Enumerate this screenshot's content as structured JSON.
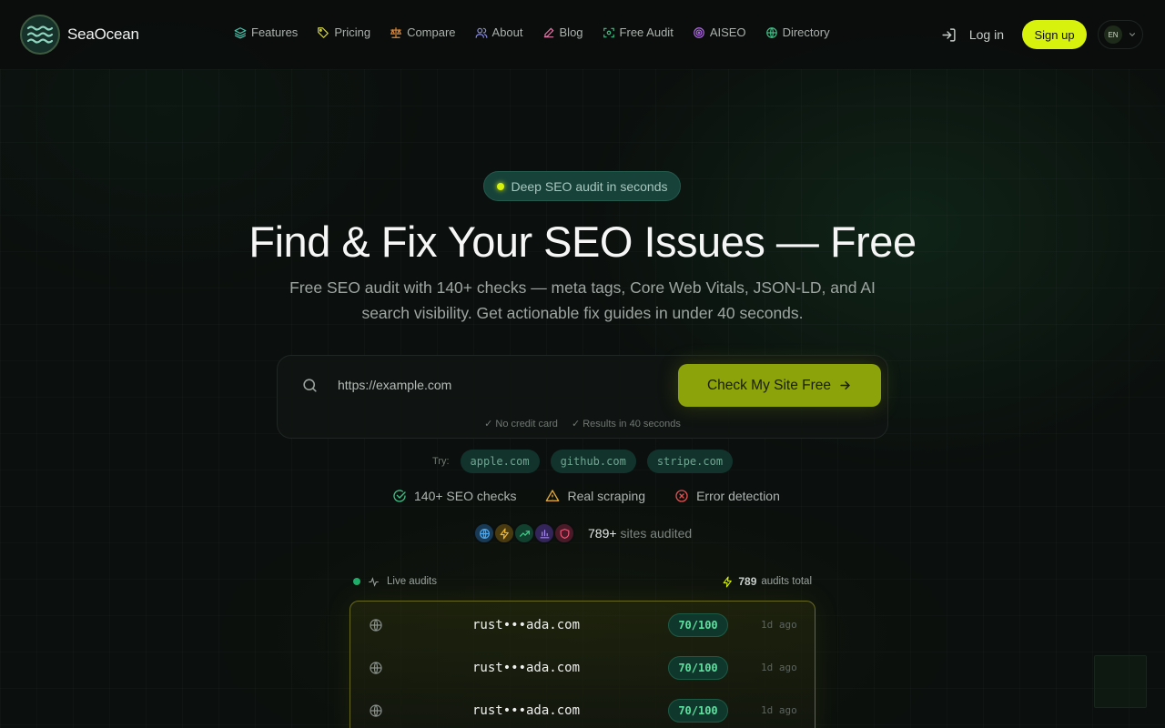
{
  "brand": {
    "name": "SeaOcean"
  },
  "nav": {
    "links": [
      {
        "label": "Features",
        "icon": "layers-icon",
        "color": "#48c0a8"
      },
      {
        "label": "Pricing",
        "icon": "tag-icon",
        "color": "#d6d84a"
      },
      {
        "label": "Compare",
        "icon": "scale-icon",
        "color": "#e08a3a"
      },
      {
        "label": "About",
        "icon": "users-icon",
        "color": "#8a8cf0"
      },
      {
        "label": "Blog",
        "icon": "pen-icon",
        "color": "#e07aa8"
      },
      {
        "label": "Free Audit",
        "icon": "scan-icon",
        "color": "#3fbf86"
      },
      {
        "label": "AISEO",
        "icon": "target-icon",
        "color": "#b06be8"
      },
      {
        "label": "Directory",
        "icon": "globe-icon",
        "color": "#3fbf86"
      }
    ],
    "login_label": "Log in",
    "signup_label": "Sign up",
    "lang_label": "EN"
  },
  "hero": {
    "badge": "Deep SEO audit in seconds",
    "title": "Find & Fix Your SEO Issues — Free",
    "subtitle": "Free SEO audit with 140+ checks — meta tags, Core Web Vitals, JSON-LD, and AI search visibility. Get actionable fix guides in under 40 seconds."
  },
  "search": {
    "placeholder": "https://example.com",
    "value": "",
    "button_label": "Check My Site Free",
    "notes": [
      "✓ No credit card",
      "✓ Results in 40 seconds"
    ],
    "try_label": "Try:",
    "examples": [
      "apple.com",
      "github.com",
      "stripe.com"
    ]
  },
  "features": [
    {
      "label": "140+ SEO checks",
      "icon": "check-circle-icon",
      "color": "#3fbf86"
    },
    {
      "label": "Real scraping",
      "icon": "warning-icon",
      "color": "#e0a83a"
    },
    {
      "label": "Error detection",
      "icon": "x-circle-icon",
      "color": "#e05050"
    }
  ],
  "audited": {
    "count": "789+",
    "label": "sites audited",
    "avatars": [
      {
        "icon": "globe-icon",
        "bg": "#183a56",
        "color": "#4aa8f0"
      },
      {
        "icon": "bolt-icon",
        "bg": "#4a3a10",
        "color": "#f0b82a"
      },
      {
        "icon": "trend-icon",
        "bg": "#12402e",
        "color": "#3fd08a"
      },
      {
        "icon": "bar-chart-icon",
        "bg": "#33245a",
        "color": "#a78af0"
      },
      {
        "icon": "shield-icon",
        "bg": "#4a1a28",
        "color": "#f05a7a"
      }
    ]
  },
  "live": {
    "label": "Live audits",
    "total_count": "789",
    "total_label": "audits total",
    "rows": [
      {
        "domain": "rust•••ada.com",
        "score": "70/100",
        "time": "1d ago"
      },
      {
        "domain": "rust•••ada.com",
        "score": "70/100",
        "time": "1d ago"
      },
      {
        "domain": "rust•••ada.com",
        "score": "70/100",
        "time": "1d ago"
      }
    ]
  }
}
